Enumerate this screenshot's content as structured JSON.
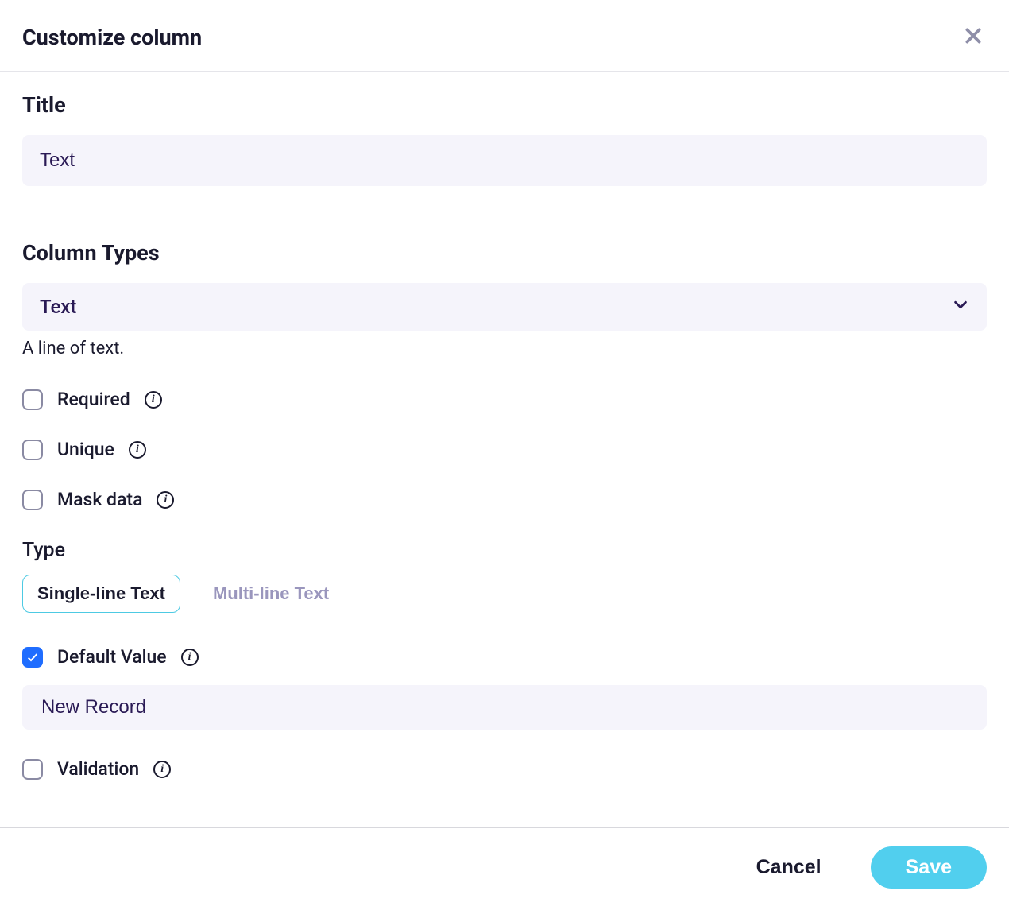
{
  "header": {
    "title": "Customize column"
  },
  "titleSection": {
    "label": "Title",
    "value": "Text"
  },
  "columnTypes": {
    "label": "Column Types",
    "selected": "Text",
    "helper": "A line of text."
  },
  "options": {
    "required": {
      "label": "Required",
      "checked": false
    },
    "unique": {
      "label": "Unique",
      "checked": false
    },
    "maskData": {
      "label": "Mask data",
      "checked": false
    }
  },
  "typeSection": {
    "label": "Type",
    "tabs": {
      "single": "Single-line Text",
      "multi": "Multi-line Text"
    },
    "active": "single"
  },
  "defaultValue": {
    "label": "Default Value",
    "checked": true,
    "value": "New Record"
  },
  "validation": {
    "label": "Validation",
    "checked": false
  },
  "footer": {
    "cancel": "Cancel",
    "save": "Save"
  },
  "infoChar": "i"
}
